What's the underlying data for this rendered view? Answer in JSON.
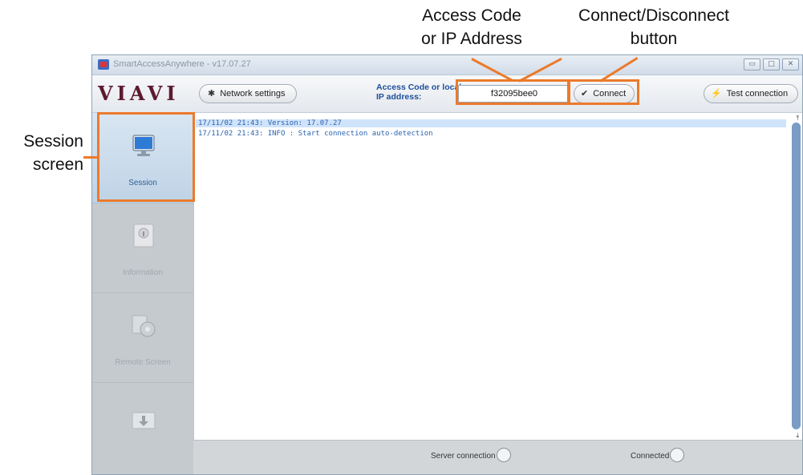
{
  "callouts": {
    "access_code_line1": "Access Code",
    "access_code_line2": "or IP Address",
    "connect_line1": "Connect/Disconnect",
    "connect_line2": "button",
    "session_line1": "Session",
    "session_line2": "screen"
  },
  "window": {
    "title": "SmartAccessAnywhere - v17.07.27",
    "min_glyph": "▭",
    "max_glyph": "□",
    "close_glyph": "✕"
  },
  "toolbar": {
    "logo": "VIAVI",
    "network_settings_label": "Network settings",
    "network_settings_icon": "gear-icon",
    "access_label_line1": "Access Code or local",
    "access_label_line2": "IP address:",
    "access_code_value": "f32095bee0",
    "connect_label": "Connect",
    "connect_icon": "check-icon",
    "test_connection_label": "Test connection",
    "test_connection_icon": "plug-icon"
  },
  "sidebar": {
    "items": [
      {
        "label": "Session",
        "icon": "monitor-icon",
        "state": "active"
      },
      {
        "label": "Information",
        "icon": "info-icon",
        "state": "disabled"
      },
      {
        "label": "Remote Screen",
        "icon": "remote-screen-icon",
        "state": "disabled"
      },
      {
        "label": "",
        "icon": "download-icon",
        "state": "disabled"
      }
    ]
  },
  "log": {
    "lines": [
      "17/11/02 21:43: Version: 17.07.27",
      "17/11/02 21:43: INFO : Start connection auto-detection"
    ]
  },
  "status": {
    "server_connection_label": "Server connection",
    "connected_label": "Connected"
  },
  "colors": {
    "callout_orange": "#ec7a2b",
    "logo": "#5c1a2e",
    "link_blue": "#2b63b0",
    "active_nav": "#c8dcee",
    "scrollbar": "#7a9cc5"
  }
}
